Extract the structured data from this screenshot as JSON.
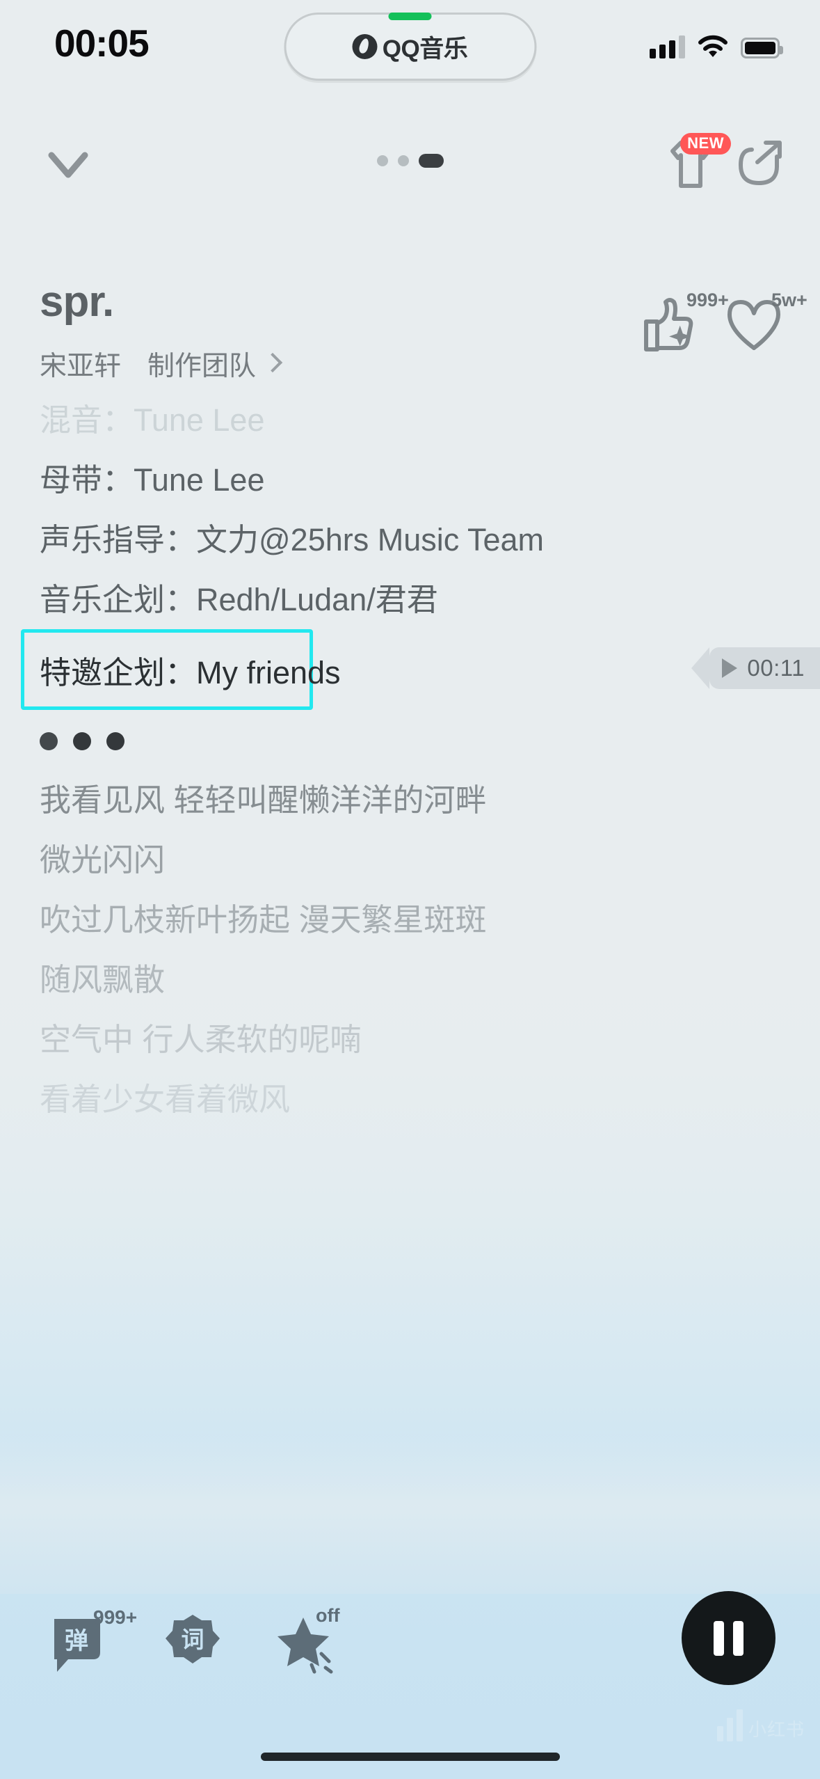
{
  "status_bar": {
    "time": "00:05",
    "dynamic_island": {
      "app_label": "QQ音乐",
      "icon": "qq-music-logo"
    },
    "signal_icon": "cellular-signal-icon",
    "wifi_icon": "wifi-icon",
    "battery_icon": "battery-full-icon"
  },
  "nav_bar": {
    "collapse_icon": "chevron-down-icon",
    "page_dots": [
      "dot-1",
      "dot-2",
      "dot-3-active"
    ],
    "tshirt_icon": "tshirt-icon",
    "tshirt_badge": "NEW",
    "share_icon": "share-arrow-icon"
  },
  "song": {
    "title": "spr.",
    "artist": "宋亚轩",
    "team_label": "制作团队",
    "team_chevron_icon": "chevron-right-icon"
  },
  "reactions": {
    "like": {
      "icon": "thumbs-up-sparkle-icon",
      "count": "999+"
    },
    "favorite": {
      "icon": "heart-outline-icon",
      "count": "5w+"
    }
  },
  "credits": [
    {
      "text": "混音：Tune Lee",
      "style": "ghost"
    },
    {
      "text": "母带：Tune Lee",
      "style": "strong"
    },
    {
      "text": "声乐指导：文力@25hrs Music Team",
      "style": "strong"
    },
    {
      "text": "音乐企划：Redh/Ludan/君君",
      "style": "strong"
    }
  ],
  "highlighted_line": {
    "text": "特邀企划：My friends",
    "highlight_color": "#22e8ef"
  },
  "seek_tooltip": {
    "play_icon": "play-triangle-icon",
    "time": "00:11"
  },
  "interlude_dots": [
    "dot",
    "dot",
    "dot"
  ],
  "lyrics": [
    {
      "text": "我看见风 轻轻叫醒懒洋洋的河畔",
      "opacity": 1.0,
      "color": "#868d91"
    },
    {
      "text": "微光闪闪",
      "opacity": 1.0,
      "color": "#9aa1a5"
    },
    {
      "text": "吹过几枝新叶扬起 漫天繁星斑斑",
      "opacity": 0.85,
      "color": "#a7aeb2"
    },
    {
      "text": "随风飘散",
      "opacity": 0.75,
      "color": "#b2b9bd"
    },
    {
      "text": "空气中 行人柔软的呢喃",
      "opacity": 0.45,
      "color": "#bcc3c7"
    },
    {
      "text": "看着少女看着微风",
      "opacity": 0.15,
      "color": "#c6ccd0"
    }
  ],
  "bottom_bar": {
    "danmaku": {
      "icon": "danmaku-bubble-icon",
      "label": "弹",
      "count": "999+"
    },
    "lyrics_toggle": {
      "icon": "lyrics-flower-icon",
      "label": "词"
    },
    "effects": {
      "icon": "star-sparkle-icon",
      "state": "off"
    },
    "play_pause": {
      "icon": "pause-icon",
      "state": "playing"
    }
  },
  "watermark": {
    "text": "小红书"
  }
}
